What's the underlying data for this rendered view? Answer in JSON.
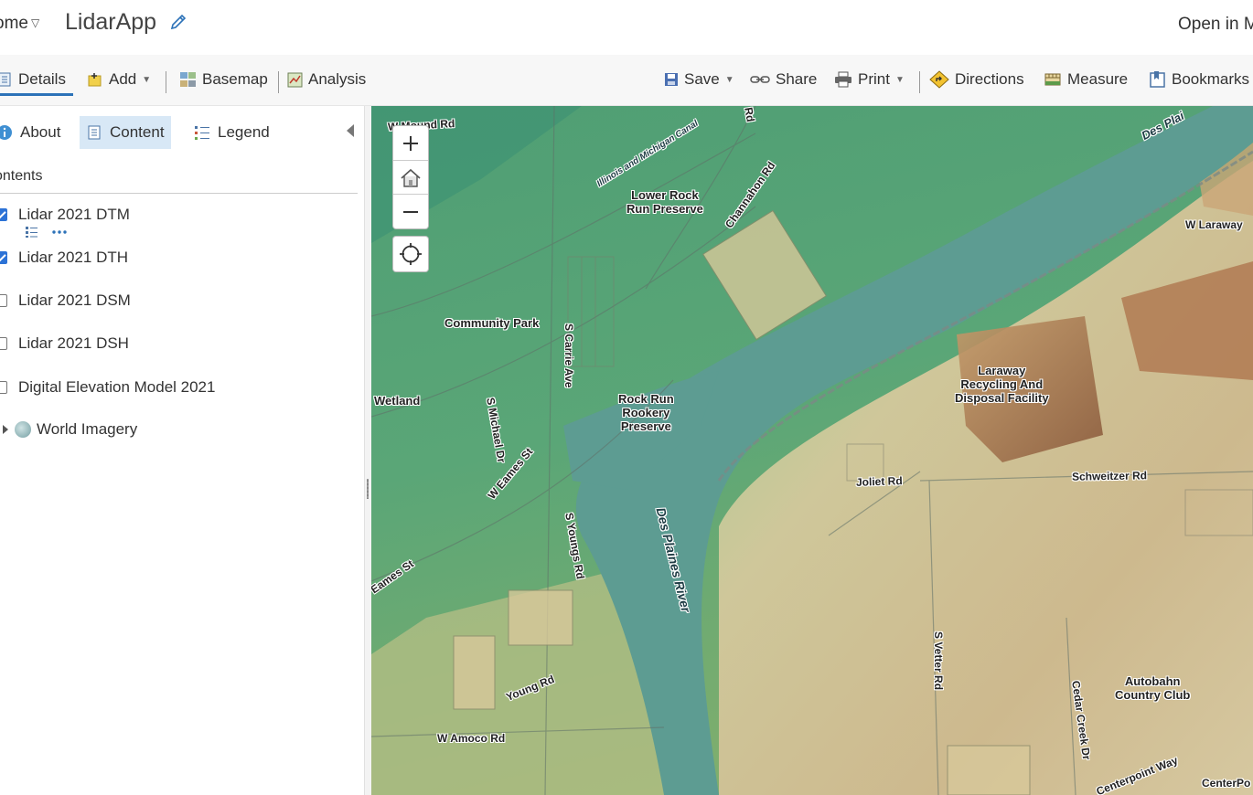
{
  "header": {
    "home_label": "ome",
    "app_title": "LidarApp",
    "open_in_label": "Open in M"
  },
  "toolbar": {
    "details": "Details",
    "add": "Add",
    "basemap": "Basemap",
    "analysis": "Analysis",
    "save": "Save",
    "share": "Share",
    "print": "Print",
    "directions": "Directions",
    "measure": "Measure",
    "bookmarks": "Bookmarks"
  },
  "panel": {
    "tabs": {
      "about": "About",
      "content": "Content",
      "legend": "Legend"
    },
    "contents_heading": "ontents",
    "layers": [
      {
        "label": "Lidar 2021 DTM",
        "checked": true
      },
      {
        "label": "Lidar 2021 DTH",
        "checked": true
      },
      {
        "label": "Lidar 2021 DSM",
        "checked": false
      },
      {
        "label": "Lidar 2021 DSH",
        "checked": false
      },
      {
        "label": "Digital Elevation Model 2021",
        "checked": false
      },
      {
        "label": "World Imagery",
        "checked": null
      }
    ]
  },
  "map": {
    "labels": {
      "w_mound_rd": "W Mound Rd",
      "il_mi_canal": "Illinois and Michigan Canal",
      "lower_rock": "Lower Rock\nRun Preserve",
      "channahon_rd": "Channahon Rd",
      "des_plaines_top": "Des Plai",
      "w_laraway": "W Laraway",
      "community_park": "Community Park",
      "s_carrie_ave": "S Carrie Ave",
      "laraway": "Laraway\nRecycling And\nDisposal Facility",
      "wetland": "Wetland",
      "rock_run": "Rock Run\nRookery\nPreserve",
      "s_michael_dr": "S Michael Dr",
      "w_eames_st": "W Eames St",
      "joliet_rd": "Joliet Rd",
      "schweitzer_rd": "Schweitzer Rd",
      "eames_st": "Eames St",
      "s_youngs_rd": "S Youngs Rd",
      "des_plaines_river": "Des Plaines River",
      "s_vetter_rd": "S Vetter Rd",
      "young_rd": "Young Rd",
      "autobahn": "Autobahn\nCountry Club",
      "cedar_creek_dr": "Cedar Creek Dr",
      "w_amoco_rd": "W Amoco Rd",
      "centerpoint_way": "Centerpoint Way",
      "centerpo": "CenterPo",
      "rd_top": "Rd"
    }
  }
}
